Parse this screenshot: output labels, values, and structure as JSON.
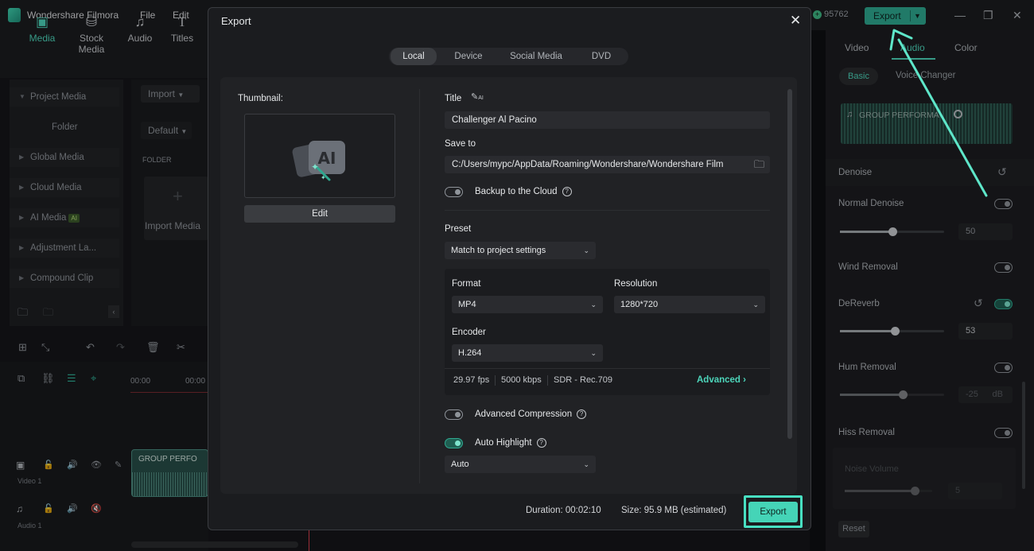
{
  "app": {
    "name": "Wondershare Filmora",
    "menu": [
      "File",
      "Edit"
    ],
    "credits": "95762",
    "top_export_label": "Export"
  },
  "library": {
    "tabs": [
      {
        "label": "Media",
        "icon": "media-icon"
      },
      {
        "label": "Stock Media",
        "icon": "stock-media-icon"
      },
      {
        "label": "Audio",
        "icon": "audio-icon"
      },
      {
        "label": "Titles",
        "icon": "titles-icon"
      }
    ],
    "nav": [
      {
        "label": "Project Media"
      },
      {
        "label": "Folder"
      },
      {
        "label": "Global Media"
      },
      {
        "label": "Cloud Media"
      },
      {
        "label": "AI Media",
        "badge": "AI"
      },
      {
        "label": "Adjustment La..."
      },
      {
        "label": "Compound Clip"
      }
    ],
    "import_label": "Import",
    "sort_label": "Default",
    "folder_header": "FOLDER",
    "import_media_label": "Import Media"
  },
  "timeline": {
    "ruler": [
      "00:00",
      "00:00"
    ],
    "clip_label": "GROUP PERFO",
    "tracks": [
      {
        "label": "Video 1"
      },
      {
        "label": "Audio 1"
      }
    ]
  },
  "inspector": {
    "tabs": [
      "Video",
      "Audio",
      "Color"
    ],
    "subtabs": [
      "Basic",
      "Voice Changer"
    ],
    "waveform_label": "GROUP PERFORMA",
    "denoise_label": "Denoise",
    "normal_denoise": {
      "label": "Normal Denoise",
      "on": false,
      "value": "50",
      "level": 0.5
    },
    "wind_removal": {
      "label": "Wind Removal",
      "on": false
    },
    "dereverb": {
      "label": "DeReverb",
      "on": true,
      "value": "53",
      "level": 0.53
    },
    "hum_removal": {
      "label": "Hum Removal",
      "on": false,
      "value": "-25",
      "unit": "dB",
      "level": 0.6
    },
    "hiss_removal": {
      "label": "Hiss Removal",
      "on": false
    },
    "noise_volume": {
      "label": "Noise Volume",
      "value": "5",
      "level": 0.8
    },
    "reset_label": "Reset"
  },
  "dialog": {
    "title": "Export",
    "tabs": [
      "Local",
      "Device",
      "Social Media",
      "DVD"
    ],
    "active_tab": "Local",
    "thumbnail_label": "Thumbnail:",
    "edit_label": "Edit",
    "title_label": "Title",
    "title_value": "Challenger Al Pacino",
    "save_to_label": "Save to",
    "save_to_value": "C:/Users/mypc/AppData/Roaming/Wondershare/Wondershare Film",
    "backup_label": "Backup to the Cloud",
    "backup_on": false,
    "preset_label": "Preset",
    "preset_value": "Match to project settings",
    "format_label": "Format",
    "format_value": "MP4",
    "resolution_label": "Resolution",
    "resolution_value": "1280*720",
    "encoder_label": "Encoder",
    "encoder_value": "H.264",
    "fps": "29.97 fps",
    "bitrate": "5000 kbps",
    "color_space": "SDR - Rec.709",
    "advanced_label": "Advanced",
    "adv_compression_label": "Advanced Compression",
    "adv_compression_on": false,
    "auto_highlight_label": "Auto Highlight",
    "auto_highlight_on": true,
    "auto_highlight_value": "Auto",
    "duration_label": "Duration:",
    "duration_value": "00:02:10",
    "size_label": "Size:",
    "size_value": "95.9 MB (estimated)",
    "export_label": "Export"
  },
  "colors": {
    "accent": "#45d4b7",
    "highlight_frame": "#48e0c2"
  }
}
